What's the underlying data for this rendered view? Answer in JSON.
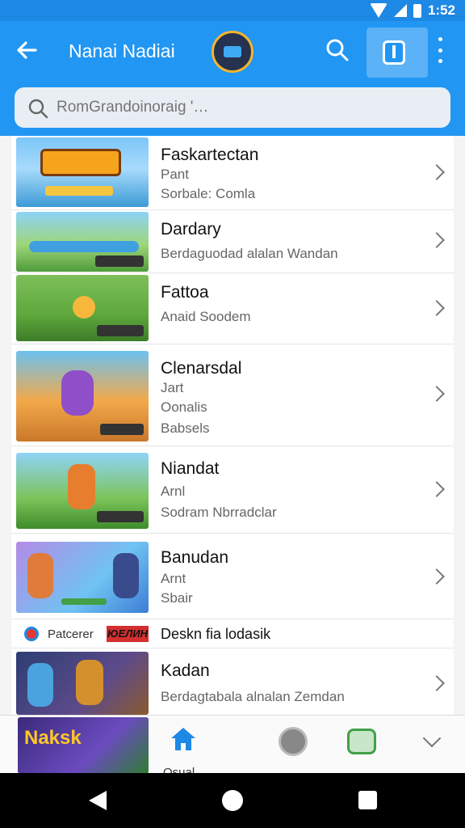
{
  "status_bar": {
    "time": "1:52"
  },
  "app_bar": {
    "title": "Nanai Nadiai"
  },
  "search": {
    "placeholder": "RomGrandoinoraig '…"
  },
  "games": [
    {
      "title": "Faskartectan",
      "lines": [
        "Pant",
        "Sorbale: Comla"
      ]
    },
    {
      "title": "Dardary",
      "lines": [
        "Berdaguodad alalan Wandan"
      ]
    },
    {
      "title": "Fattoa",
      "lines": [
        "Anaid Soodem"
      ]
    },
    {
      "title": "Clenarsdal",
      "lines": [
        "Jart",
        "Oonalis",
        "Babsels"
      ]
    },
    {
      "title": "Niandat",
      "lines": [
        "Arnl",
        "Sodram Nbrradclar"
      ]
    },
    {
      "title": "Banudan",
      "lines": [
        "Arnt",
        "Sbair"
      ]
    },
    {
      "title": "Kadan",
      "lines": [
        "Berdagtabala alnalan Zemdan"
      ]
    }
  ],
  "banner": {
    "label": "Patcerer",
    "tag": "ЮЕЛИН",
    "title": "Deskn fia lodasik"
  },
  "bottom_nav": {
    "thumb_label": "Naksk",
    "home_label": "Osual"
  },
  "colors": {
    "primary": "#2196f3",
    "status": "#1e88e5"
  },
  "icons": [
    "back-arrow-icon",
    "search-icon",
    "tablet-icon",
    "more-vert-icon",
    "home-icon",
    "helmet-icon",
    "chat-icon",
    "chevron-down-icon"
  ]
}
